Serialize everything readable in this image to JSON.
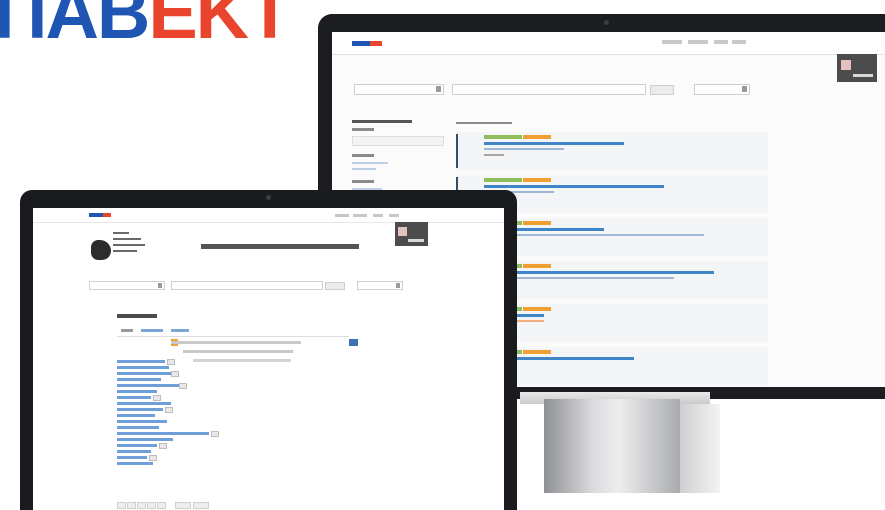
{
  "logo": {
    "text_part1": "ΠΑΒ",
    "text_part2": "ΕΚΤ",
    "color_primary": "#1f56b3",
    "color_accent": "#e8452c"
  },
  "devices": {
    "monitor_color": "#1b1d20",
    "laptop_color": "#1a1b1e",
    "stand_color": "#c9cacc"
  }
}
